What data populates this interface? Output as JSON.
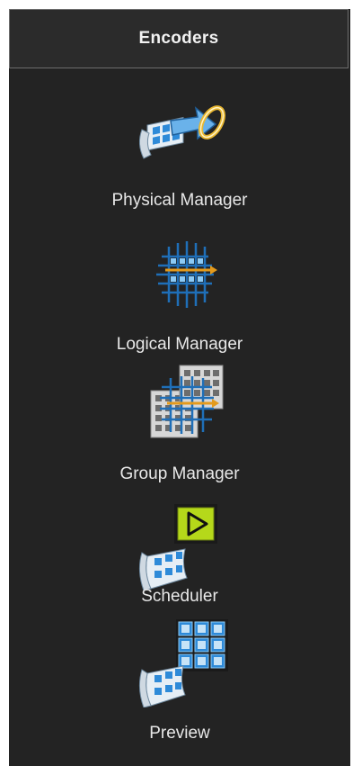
{
  "panel": {
    "title": "Encoders",
    "items": [
      {
        "label": "Physical Manager",
        "icon": "physical-manager-icon"
      },
      {
        "label": "Logical Manager",
        "icon": "logical-manager-icon"
      },
      {
        "label": "Group Manager",
        "icon": "group-manager-icon"
      },
      {
        "label": "Scheduler",
        "icon": "scheduler-icon"
      },
      {
        "label": "Preview",
        "icon": "preview-icon"
      }
    ]
  },
  "colors": {
    "background": "#232323",
    "header_background": "#2b2b2b",
    "header_border": "#6d6d6d",
    "text": "#e8e8e8",
    "icon_blue": "#2e8ad8",
    "icon_orange": "#e39a1c",
    "scheduler_green": "#b5d81a"
  }
}
